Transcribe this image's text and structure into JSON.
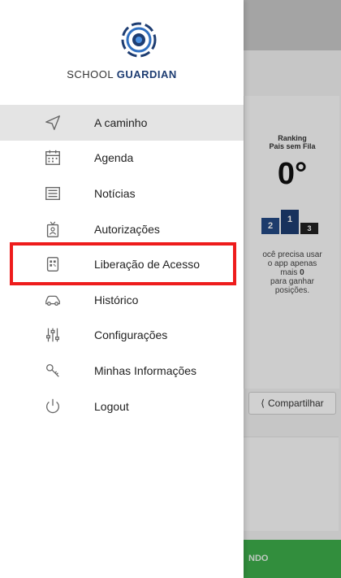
{
  "brand": {
    "prefix": "SCHOOL",
    "name": "GUARDIAN"
  },
  "menu": {
    "items": [
      {
        "label": "A caminho",
        "icon": "send-icon",
        "active": true
      },
      {
        "label": "Agenda",
        "icon": "calendar-icon"
      },
      {
        "label": "Notícias",
        "icon": "news-icon"
      },
      {
        "label": "Autorizações",
        "icon": "badge-icon"
      },
      {
        "label": "Liberação de Acesso",
        "icon": "qr-code-icon"
      },
      {
        "label": "Histórico",
        "icon": "history-car-icon"
      },
      {
        "label": "Configurações",
        "icon": "sliders-icon"
      },
      {
        "label": "Minhas Informações",
        "icon": "user-info-icon"
      },
      {
        "label": "Logout",
        "icon": "power-icon"
      }
    ]
  },
  "background": {
    "ranking": {
      "title_line1": "Ranking",
      "title_line2": "Pais sem Fila",
      "position": "0°",
      "podium": [
        "2",
        "1",
        "3"
      ],
      "message_line1": "ocê precisa usar",
      "message_line2": "o app apenas",
      "message_line3_pre": "mais",
      "message_count": "0",
      "message_line4": "para ganhar",
      "message_line5": "posições."
    },
    "share_label": "Compartilhar",
    "bottom_bar_text": "NDO"
  },
  "colors": {
    "brand_blue": "#1e3d72",
    "highlight_red": "#ee1c1c",
    "green_bar": "#3dae4b"
  }
}
